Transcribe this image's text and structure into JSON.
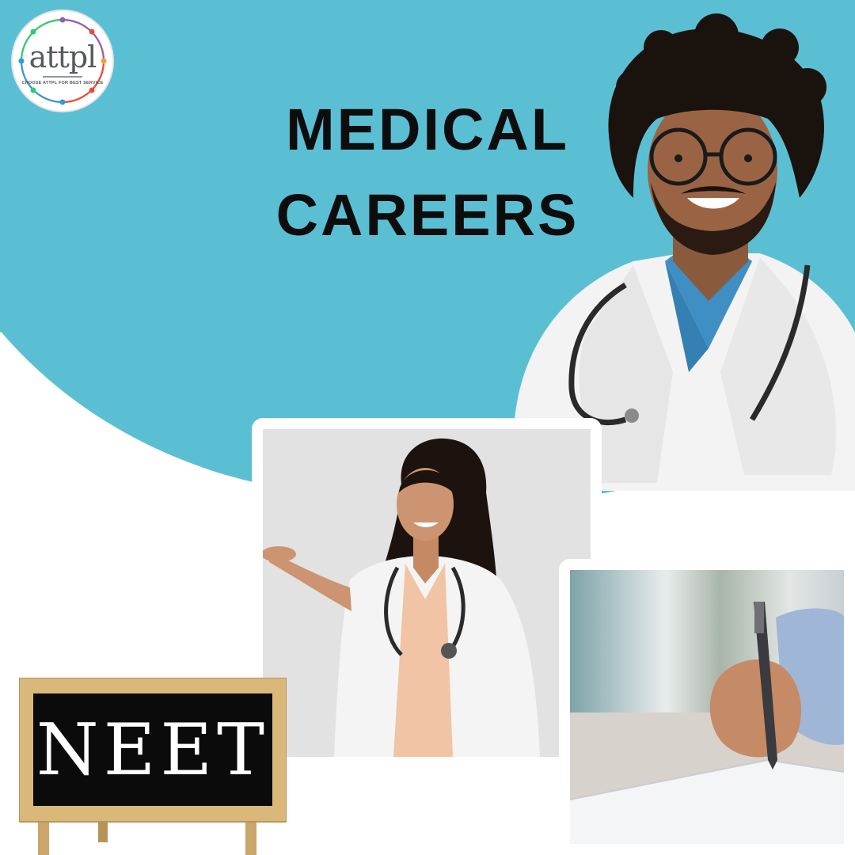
{
  "logo": {
    "wordmark": "attpl",
    "tagline": "CHOOSE ATTPL FOR BEST SERVICE"
  },
  "headline": {
    "line1": "MEDICAL",
    "line2": "CAREERS"
  },
  "board": {
    "text": "NEET"
  },
  "colors": {
    "sky": "#5bbfd4",
    "white": "#ffffff",
    "title_text": "#0d0d0d",
    "board_frame": "#d9b87a",
    "board_face": "#0b0b0b",
    "coat": "#f5f5f5",
    "scrubs": "#3f8fc4"
  },
  "images": {
    "hero": "smiling male doctor with curly hair, glasses, white coat and stethoscope",
    "card_1": "smiling female doctor with long hair in white coat and stethoscope, hand raised",
    "card_2": "hand holding a pen signing a document"
  }
}
